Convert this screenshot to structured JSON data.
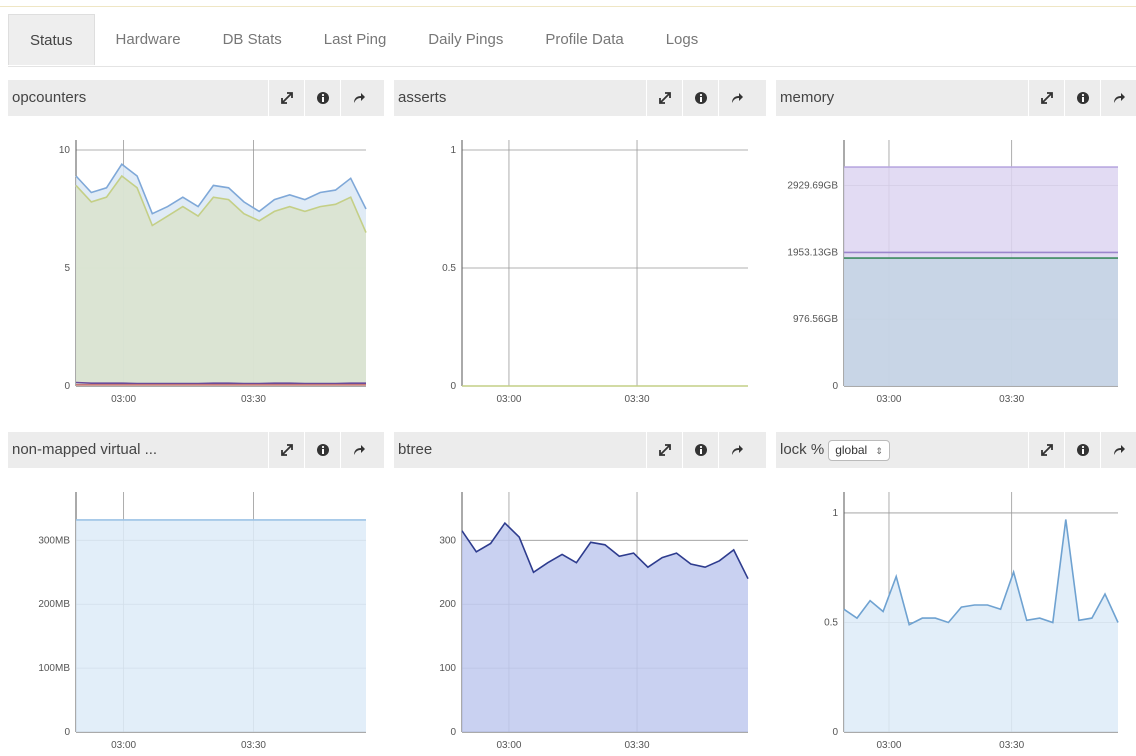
{
  "tabs": [
    {
      "label": "Status",
      "active": true
    },
    {
      "label": "Hardware",
      "active": false
    },
    {
      "label": "DB Stats",
      "active": false
    },
    {
      "label": "Last Ping",
      "active": false
    },
    {
      "label": "Daily Pings",
      "active": false
    },
    {
      "label": "Profile Data",
      "active": false
    },
    {
      "label": "Logs",
      "active": false
    }
  ],
  "panels": {
    "opcounters": {
      "title": "opcounters"
    },
    "asserts": {
      "title": "asserts"
    },
    "memory": {
      "title": "memory"
    },
    "nonmapped": {
      "title": "non-mapped virtual ..."
    },
    "btree": {
      "title": "btree"
    },
    "lock": {
      "title": "lock %",
      "select_value": "global"
    }
  },
  "chart_data": [
    {
      "id": "opcounters",
      "type": "area",
      "x": [
        "02:49",
        "02:53",
        "02:56",
        "03:00",
        "03:03",
        "03:07",
        "03:10",
        "03:14",
        "03:18",
        "03:21",
        "03:25",
        "03:28",
        "03:32",
        "03:35",
        "03:39",
        "03:42",
        "03:46",
        "03:49",
        "03:53",
        "03:56"
      ],
      "series": [
        {
          "values": [
            8.9,
            8.2,
            8.4,
            9.4,
            8.9,
            7.3,
            7.6,
            8.0,
            7.6,
            8.5,
            8.4,
            7.8,
            7.4,
            7.9,
            8.1,
            7.9,
            8.2,
            8.3,
            8.8,
            7.5
          ],
          "color": "#7fa8d8",
          "fill": "#dbe7f5"
        },
        {
          "values": [
            8.5,
            7.8,
            8.0,
            8.9,
            8.4,
            6.8,
            7.2,
            7.6,
            7.2,
            8.0,
            7.9,
            7.3,
            7.0,
            7.4,
            7.6,
            7.4,
            7.6,
            7.7,
            8.0,
            6.5
          ],
          "color": "#c4cf86",
          "fill": "#d9e3cc"
        },
        {
          "values": [
            0.15,
            0.12,
            0.12,
            0.12,
            0.1,
            0.1,
            0.1,
            0.1,
            0.1,
            0.12,
            0.12,
            0.1,
            0.1,
            0.12,
            0.12,
            0.1,
            0.1,
            0.1,
            0.12,
            0.12
          ],
          "color": "#6b4b9a"
        },
        {
          "values": [
            0.05,
            0.05,
            0.05,
            0.05,
            0.05,
            0.05,
            0.05,
            0.05,
            0.05,
            0.05,
            0.05,
            0.05,
            0.05,
            0.05,
            0.05,
            0.05,
            0.05,
            0.05,
            0.05,
            0.05
          ],
          "color": "#c77777"
        }
      ],
      "ylim": [
        0,
        10
      ],
      "yticks": [
        0,
        5,
        10
      ],
      "ytick_labels": [
        "0",
        "5",
        "10"
      ],
      "xticks": [
        "03:00",
        "03:30"
      ]
    },
    {
      "id": "asserts",
      "type": "line",
      "x": [
        "02:49",
        "03:56"
      ],
      "series": [
        {
          "values": [
            0,
            0
          ],
          "color": "#c4cf86"
        }
      ],
      "ylim": [
        0,
        1
      ],
      "yticks": [
        0,
        0.5,
        1
      ],
      "ytick_labels": [
        "0",
        "0.5",
        "1"
      ],
      "xticks": [
        "03:00",
        "03:30"
      ]
    },
    {
      "id": "memory",
      "type": "area",
      "x": [
        "02:49",
        "03:56"
      ],
      "series": [
        {
          "values": [
            3200,
            3200
          ],
          "color": "#b9a9e0",
          "fill": "#ddd5f1"
        },
        {
          "values": [
            1953.13,
            1953.13
          ],
          "color": "#9b86cc"
        },
        {
          "values": [
            1870,
            1870
          ],
          "color": "#3c8a5f",
          "fill": "#c3d3e3"
        }
      ],
      "ylim": [
        0,
        3450
      ],
      "yticks": [
        0,
        976.56,
        1953.13,
        2929.69
      ],
      "ytick_labels": [
        "0",
        "976.56GB",
        "1953.13GB",
        "2929.69GB"
      ],
      "xticks": [
        "03:00",
        "03:30"
      ]
    },
    {
      "id": "nonmapped",
      "type": "area",
      "x": [
        "02:49",
        "03:56"
      ],
      "series": [
        {
          "values": [
            332,
            332
          ],
          "color": "#9cc3e6",
          "fill": "#ddebf8"
        }
      ],
      "ylim": [
        0,
        360
      ],
      "yticks": [
        0,
        100,
        200,
        300
      ],
      "ytick_labels": [
        "0",
        "100MB",
        "200MB",
        "300MB"
      ],
      "xticks": [
        "03:00",
        "03:30"
      ]
    },
    {
      "id": "btree",
      "type": "area",
      "x": [
        "02:49",
        "02:53",
        "02:56",
        "03:00",
        "03:03",
        "03:07",
        "03:10",
        "03:14",
        "03:18",
        "03:21",
        "03:25",
        "03:28",
        "03:32",
        "03:35",
        "03:39",
        "03:42",
        "03:46",
        "03:49",
        "03:53",
        "03:56"
      ],
      "series": [
        {
          "values": [
            315,
            282,
            295,
            327,
            305,
            250,
            265,
            278,
            265,
            297,
            293,
            275,
            280,
            258,
            273,
            280,
            263,
            258,
            268,
            285,
            240
          ],
          "color": "#2e3c8e",
          "fill": "#c0c9ee"
        }
      ],
      "ylim": [
        0,
        360
      ],
      "yticks": [
        0,
        100,
        200,
        300
      ],
      "ytick_labels": [
        "0",
        "100",
        "200",
        "300"
      ],
      "xticks": [
        "03:00",
        "03:30"
      ]
    },
    {
      "id": "lock",
      "type": "area",
      "x": [
        "02:49",
        "02:53",
        "02:56",
        "03:00",
        "03:03",
        "03:07",
        "03:10",
        "03:14",
        "03:18",
        "03:21",
        "03:25",
        "03:28",
        "03:32",
        "03:35",
        "03:39",
        "03:42",
        "03:46",
        "03:49",
        "03:53",
        "03:56"
      ],
      "series": [
        {
          "values": [
            0.56,
            0.52,
            0.6,
            0.55,
            0.71,
            0.49,
            0.52,
            0.52,
            0.5,
            0.57,
            0.58,
            0.58,
            0.56,
            0.73,
            0.51,
            0.52,
            0.5,
            0.97,
            0.51,
            0.52,
            0.63,
            0.5
          ],
          "color": "#6fa2d1",
          "fill": "#ddebf8"
        }
      ],
      "ylim": [
        0,
        1.05
      ],
      "yticks": [
        0,
        0.5,
        1
      ],
      "ytick_labels": [
        "0",
        "0.5",
        "1"
      ],
      "xticks": [
        "03:00",
        "03:30"
      ]
    }
  ]
}
